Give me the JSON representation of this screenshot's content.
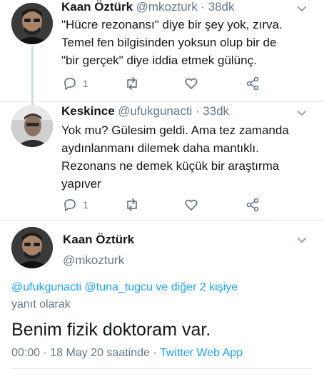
{
  "tweets": [
    {
      "name": "Kaan Öztürk",
      "handle": "@mkozturk",
      "time": "· 38dk",
      "lines": [
        "\"Hücre rezonansı\" diye bir şey yok, zırva.",
        "Temel fen bilgisinden yoksun olup bir de",
        "\"bir gerçek\" diye iddia etmek gülünç."
      ],
      "reply_count": "1"
    },
    {
      "name": "Keskince",
      "handle": "@ufukgunacti",
      "time": "· 33dk",
      "lines": [
        "Yok mu? Gülesim geldi. Ama tez zamanda",
        "aydınlanmanı dilemek daha mantıklı.",
        "Rezonans ne demek küçük bir araştırma",
        "yapıver"
      ],
      "reply_count": "1"
    }
  ],
  "main_tweet": {
    "name": "Kaan Öztürk",
    "handle": "@mkozturk",
    "reply_to": {
      "user1": "@ufukgunacti",
      "user2": "@tuna_tugcu",
      "others": "ve diğer 2 kişiye",
      "suffix": "yanıt olarak"
    },
    "text": "Benim fizik doktoram var.",
    "timestamp": "00:00 · 18 May 20 saatinde ·",
    "source": "Twitter Web App"
  },
  "icons": [
    "reply-icon",
    "retweet-icon",
    "like-icon",
    "share-icon",
    "chevron-down-icon"
  ],
  "colors": {
    "link": "#1da1f2",
    "secondary": "#657786",
    "divider": "#e1e8ed"
  }
}
